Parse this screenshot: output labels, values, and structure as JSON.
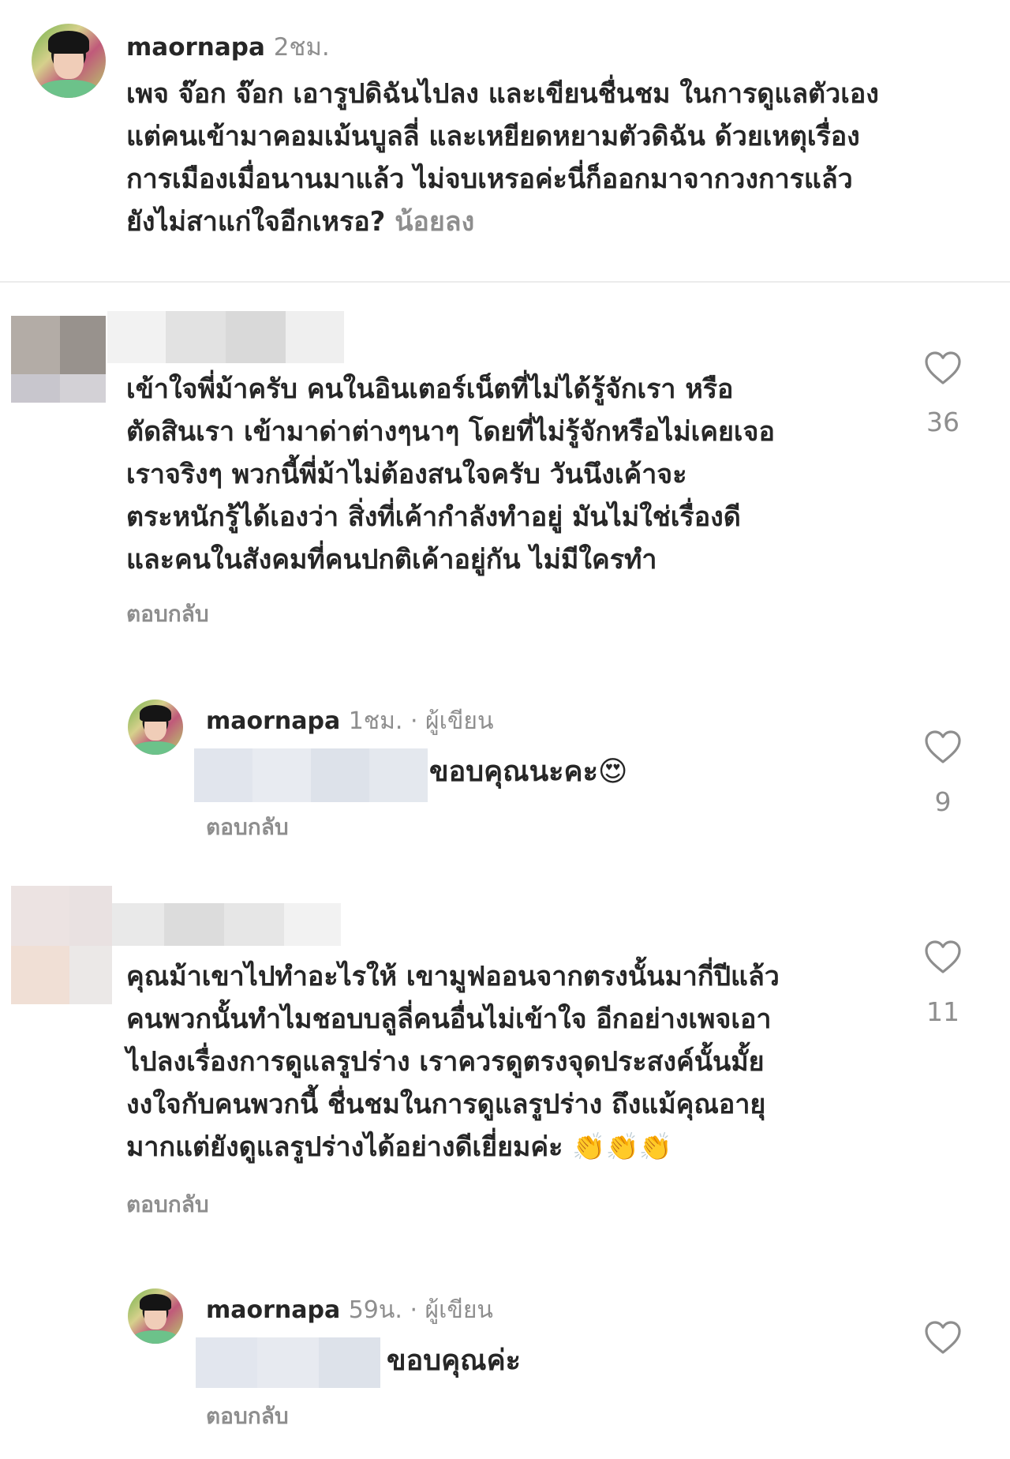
{
  "post": {
    "username": "maornapa",
    "time": "2ชม.",
    "caption": "เพจ จ๊อก จ๊อก เอารูปดิฉันไปลง และเขียนชื่นชม ในการดูแลตัวเอง\nแต่คนเข้ามาคอมเม้นบูลลี่ และเหยียดหยามตัวดิฉัน ด้วยเหตุเรื่อง\nการเมืองเมื่อนานมาแล้ว ไม่จบเหรอค่ะนี่ก็ออกมาจากวงการแล้ว\nยังไม่สาแก่ใจอีกเหรอ? ",
    "less_link": "น้อยลง"
  },
  "comments": [
    {
      "text": "เข้าใจพี่ม้าครับ คนในอินเตอร์เน็ตที่ไม่ได้รู้จักเรา หรือ\nตัดสินเรา เข้ามาด่าต่างๆนาๆ โดยที่ไม่รู้จักหรือไม่เคยเจอ\nเราจริงๆ พวกนี้พี่ม้าไม่ต้องสนใจครับ วันนึงเค้าจะ\nตระหนักรู้ได้เองว่า สิ่งที่เค้ากำลังทำอยู่ มันไม่ใช่เรื่องดี\nและคนในสังคมที่คนปกติเค้าอยู่กัน ไม่มีใครทำ",
      "likes": "36",
      "reply_label": "ตอบกลับ"
    },
    {
      "username": "maornapa",
      "time": "1ชม.",
      "author_tag": " · ผู้เขียน",
      "text": "ขอบคุณนะคะ😍",
      "likes": "9",
      "reply_label": "ตอบกลับ"
    },
    {
      "text": "คุณม้าเขาไปทำอะไรให้ เขามูฟออนจากตรงนั้นมากี่ปีแล้ว\nคนพวกนั้นทำไมชอบบลูลี่คนอื่นไม่เข้าใจ อีกอย่างเพจเอา\nไปลงเรื่องการดูแลรูปร่าง เราควรดูตรงจุดประสงค์นั้นมั้ย\nงงใจกับคนพวกนี้ ชื่นชมในการดูแลรูปร่าง ถึงแม้คุณอายุ\nมากแต่ยังดูแลรูปร่างได้อย่างดีเยี่ยมค่ะ 👏👏👏",
      "likes": "11",
      "reply_label": "ตอบกลับ"
    },
    {
      "username": "maornapa",
      "time": "59น.",
      "author_tag": " · ผู้เขียน",
      "text": "ขอบคุณค่ะ",
      "reply_label": "ตอบกลับ"
    }
  ],
  "icons": {
    "like": "heart-outline-icon"
  }
}
